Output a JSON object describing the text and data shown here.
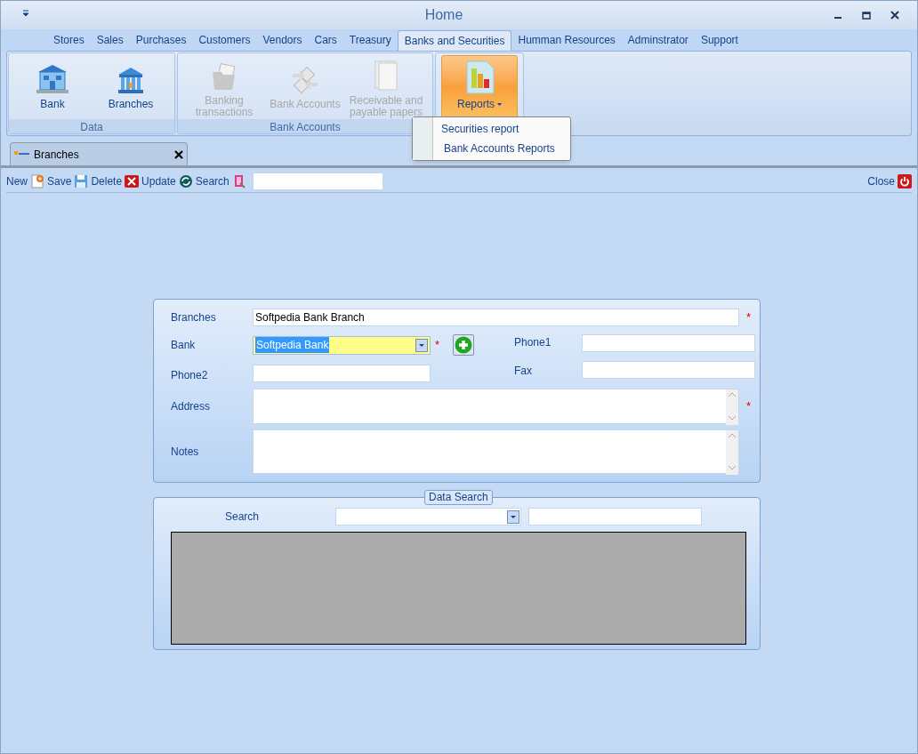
{
  "window": {
    "title": "Home"
  },
  "menu_tabs": [
    {
      "label": "Stores",
      "selected": false
    },
    {
      "label": "Sales",
      "selected": false
    },
    {
      "label": "Purchases",
      "selected": false
    },
    {
      "label": "Customers",
      "selected": false
    },
    {
      "label": "Vendors",
      "selected": false
    },
    {
      "label": "Cars",
      "selected": false
    },
    {
      "label": "Treasury",
      "selected": false
    },
    {
      "label": "Banks and Securities",
      "selected": true
    },
    {
      "label": "Humman Resources",
      "selected": false
    },
    {
      "label": "Adminstrator",
      "selected": false
    },
    {
      "label": "Support",
      "selected": false
    }
  ],
  "ribbon_groups": [
    {
      "label": "Data",
      "buttons": [
        {
          "label": "Bank",
          "disabled": false,
          "pressed": false,
          "dropdown": false
        },
        {
          "label": "Branches",
          "disabled": false,
          "pressed": false,
          "dropdown": false
        }
      ]
    },
    {
      "label": "Bank Accounts",
      "buttons": [
        {
          "label": "Banking transactions",
          "disabled": true,
          "pressed": false,
          "dropdown": false
        },
        {
          "label": "Bank Accounts",
          "disabled": true,
          "pressed": false,
          "dropdown": false
        },
        {
          "label": "Receivable and payable papers",
          "disabled": true,
          "pressed": false,
          "dropdown": false
        }
      ]
    },
    {
      "buttons": [
        {
          "label": "Reports",
          "disabled": false,
          "pressed": true,
          "dropdown": true
        }
      ]
    }
  ],
  "dropdown_menu": {
    "items": [
      "Securities report",
      "Bank Accounts Reports"
    ]
  },
  "document_tabs": [
    {
      "label": "Branches",
      "selected": true
    }
  ],
  "toolbar": {
    "buttons": [
      "New",
      "Save",
      "Delete",
      "Update",
      "Search"
    ],
    "close": "Close"
  },
  "form": {
    "required_mark": "*",
    "branches": {
      "label": "Branches",
      "value": "Softpedia Bank Branch",
      "required": true
    },
    "bank": {
      "label": "Bank",
      "value": "Softpedia Bank",
      "required": true
    },
    "phone1": {
      "label": "Phone1"
    },
    "phone2": {
      "label": "Phone2"
    },
    "fax": {
      "label": "Fax"
    },
    "address": {
      "label": "Address",
      "required": true
    },
    "notes": {
      "label": "Notes",
      "required": false
    }
  },
  "data_search": {
    "title": "Data Search",
    "label": "Search"
  }
}
